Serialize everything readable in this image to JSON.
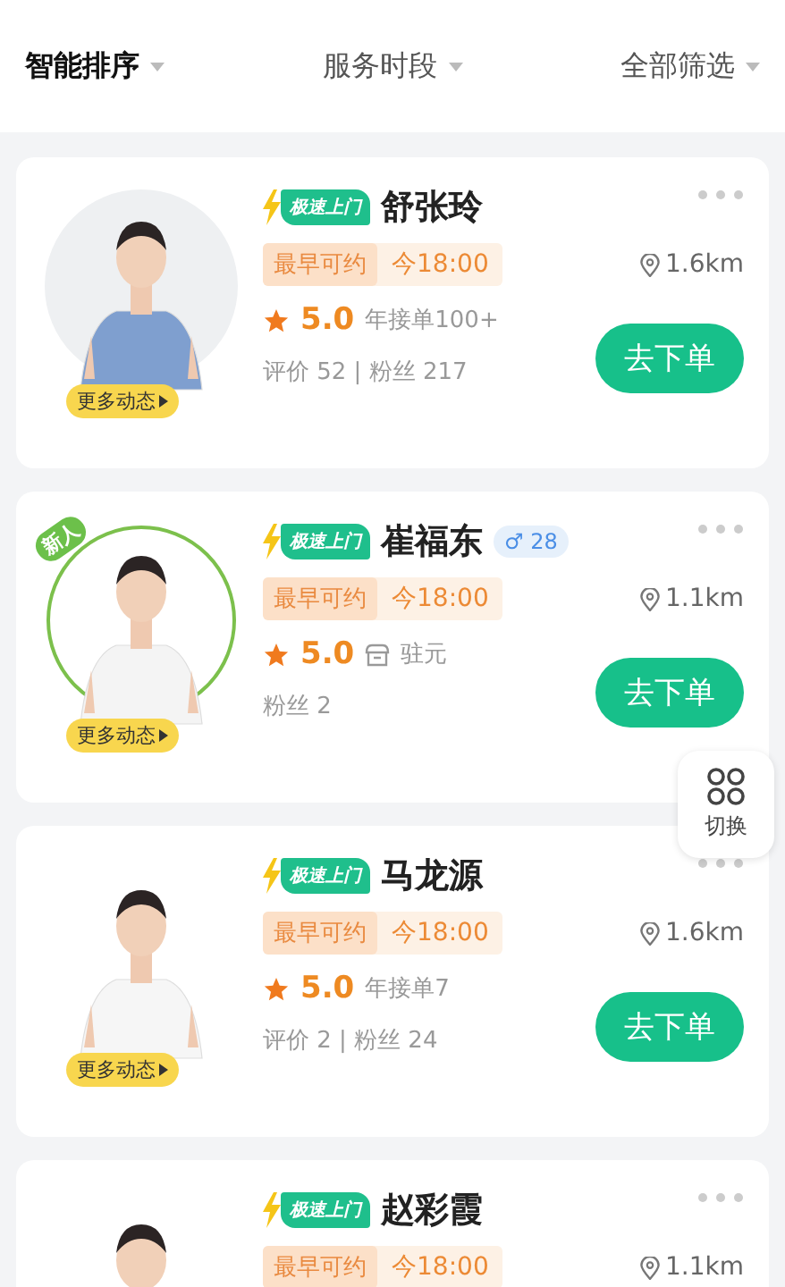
{
  "filters": [
    {
      "label": "智能排序",
      "selected": true
    },
    {
      "label": "服务时段",
      "selected": false
    },
    {
      "label": "全部筛选",
      "selected": false
    }
  ],
  "cards": [
    {
      "name": "舒张玲",
      "speed_tag": "极速上门",
      "slot_label": "最早可约",
      "slot_time": "今18:00",
      "distance": "1.6km",
      "rating": "5.0",
      "extra": {
        "kind": "plain",
        "text": "年接单100+"
      },
      "stats": "评价 52 | 粉丝 217",
      "button": "去下单",
      "more_label": "更多动态"
    },
    {
      "name": "崔福东",
      "speed_tag": "极速上门",
      "new_label": "新人",
      "gender_tag": "♂ 28",
      "slot_label": "最早可约",
      "slot_time": "今18:00",
      "distance": "1.1km",
      "rating": "5.0",
      "extra": {
        "kind": "store",
        "text": "驻元"
      },
      "stats": "粉丝 2",
      "button": "去下单",
      "more_label": "更多动态"
    },
    {
      "name": "马龙源",
      "speed_tag": "极速上门",
      "slot_label": "最早可约",
      "slot_time": "今18:00",
      "distance": "1.6km",
      "rating": "5.0",
      "extra": {
        "kind": "plain",
        "text": "年接单7"
      },
      "stats": "评价 2 | 粉丝 24",
      "button": "去下单",
      "more_label": "更多动态"
    },
    {
      "name": "赵彩霞",
      "speed_tag": "极速上门",
      "slot_label": "最早可约",
      "slot_time": "今18:00",
      "distance": "1.1km"
    }
  ],
  "switch_button": {
    "label": "切换"
  }
}
